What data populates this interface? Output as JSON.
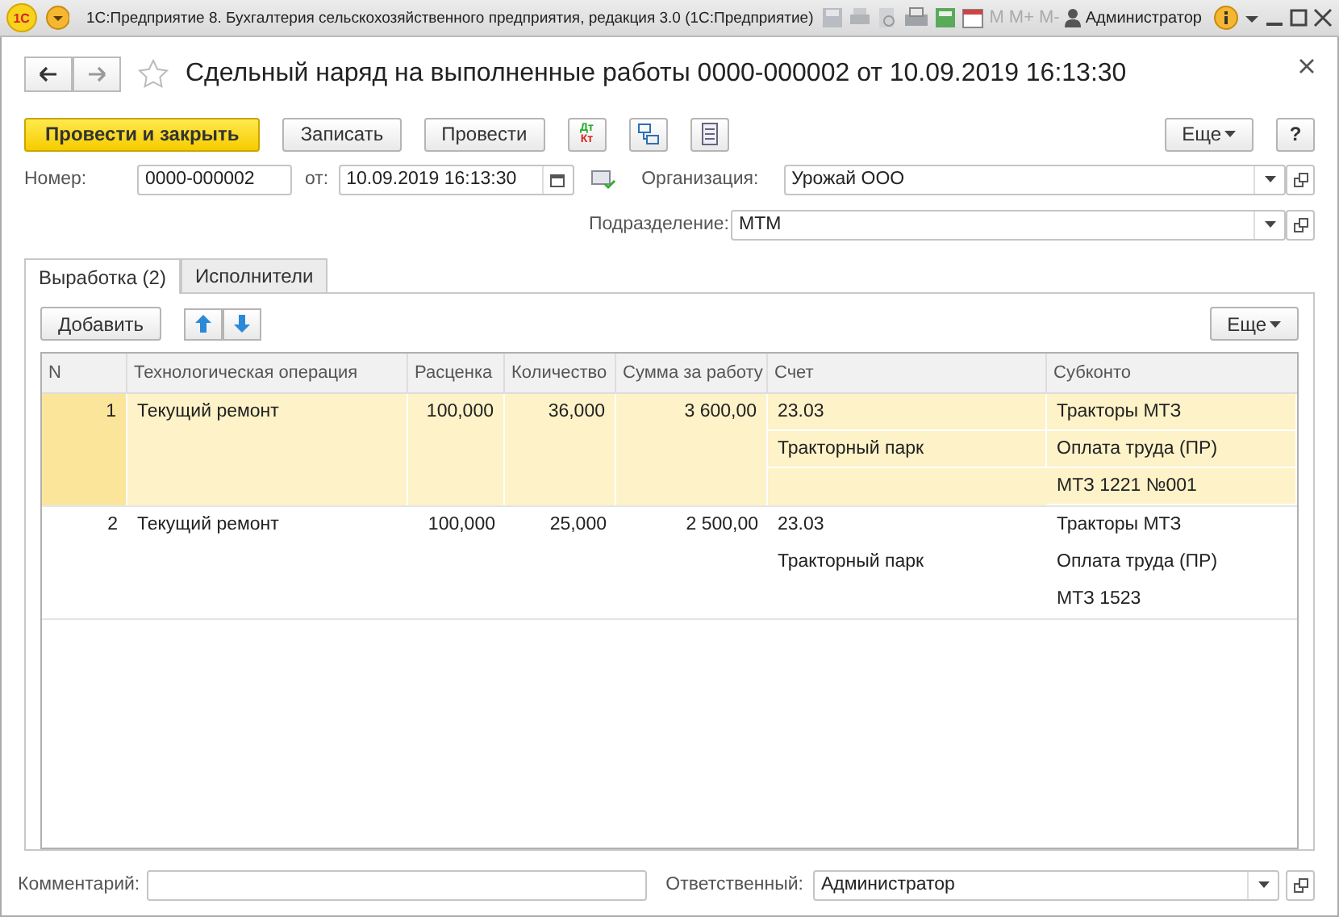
{
  "app_bar": {
    "logo": "1С",
    "title": "1С:Предприятие 8. Бухгалтерия сельскохозяйственного предприятия, редакция 3.0  (1С:Предприятие)",
    "memory_buttons": [
      "M",
      "M+",
      "M-"
    ],
    "user": "Администратор"
  },
  "document": {
    "title": "Сдельный наряд на выполненные работы 0000-000002 от 10.09.2019 16:13:30"
  },
  "toolbar": {
    "primary": "Провести и закрыть",
    "buttons": [
      "Записать",
      "Провести"
    ],
    "dt_kt": [
      "Дт",
      "Кт"
    ],
    "more": "Еще",
    "help": "?"
  },
  "fields": {
    "number": {
      "label": "Номер:",
      "value": "0000-000002"
    },
    "date": {
      "label": "от:",
      "value": "10.09.2019 16:13:30"
    },
    "organization": {
      "label": "Организация:",
      "value": "Урожай ООО"
    },
    "division": {
      "label": "Подразделение:",
      "value": "МТМ"
    }
  },
  "tabs": [
    {
      "label": "Выработка (2)",
      "selected": true
    },
    {
      "label": "Исполнители",
      "selected": false
    }
  ],
  "table_toolbar": {
    "add": "Добавить",
    "more": "Еще"
  },
  "table": {
    "columns": [
      "N",
      "Технологическая операция",
      "Расценка",
      "Количество",
      "Сумма за работу",
      "Счет",
      "Субконто"
    ],
    "rows": [
      {
        "n": "1",
        "operation": "Текущий ремонт",
        "rate": "100,000",
        "quantity": "36,000",
        "sum": "3 600,00",
        "account": [
          "23.03",
          "Тракторный парк"
        ],
        "subconto": [
          "Тракторы МТЗ",
          "Оплата труда (ПР)",
          "МТЗ 1221 №001"
        ],
        "selected": true
      },
      {
        "n": "2",
        "operation": "Текущий ремонт",
        "rate": "100,000",
        "quantity": "25,000",
        "sum": "2 500,00",
        "account": [
          "23.03",
          "Тракторный парк"
        ],
        "subconto": [
          "Тракторы МТЗ",
          "Оплата труда (ПР)",
          "МТЗ 1523"
        ],
        "selected": false
      }
    ]
  },
  "footer": {
    "comment": {
      "label": "Комментарий:"
    },
    "responsible": {
      "label": "Ответственный:",
      "value": "Администратор"
    }
  }
}
